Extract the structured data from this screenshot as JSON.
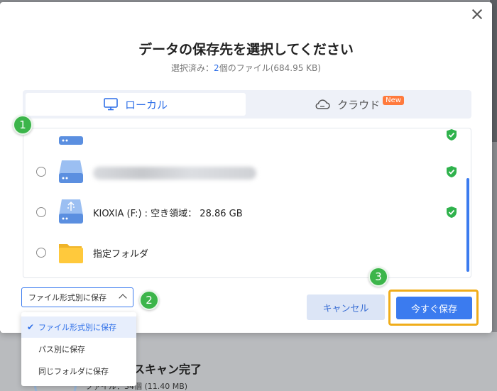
{
  "dialog": {
    "title": "データの保存先を選択してください",
    "subtitle_prefix": "選択済み：",
    "subtitle_count": "2",
    "subtitle_suffix": "個のファイル(684.95 KB)"
  },
  "tabs": [
    {
      "label": "ローカル",
      "icon": "monitor-icon",
      "active": true
    },
    {
      "label": "クラウド",
      "icon": "cloud-icon",
      "badge": "New",
      "active": false
    }
  ],
  "locations": [
    {
      "label": "",
      "icon": "drive-icon",
      "verified": true,
      "partially_visible": true
    },
    {
      "label": "",
      "icon": "drive-icon",
      "verified": true,
      "blurred": true
    },
    {
      "label": "KIOXIA (F:) : 空き領域： 28.86 GB",
      "icon": "usb-drive-icon",
      "verified": true
    },
    {
      "label": "指定フォルダ",
      "icon": "folder-icon",
      "verified": false
    }
  ],
  "format_select": {
    "value": "ファイル形式別に保存",
    "options": [
      {
        "label": "ファイル形式別に保存",
        "selected": true
      },
      {
        "label": "パス別に保存",
        "selected": false
      },
      {
        "label": "同じフォルダに保存",
        "selected": false
      }
    ]
  },
  "buttons": {
    "cancel": "キャンセル",
    "save": "今すぐ保存"
  },
  "markers": [
    "1",
    "2",
    "3"
  ],
  "background_app": {
    "status_title": "スキャン完了",
    "status_sub": "ファイル：34個 (11.40 MB)"
  },
  "colors": {
    "accent": "#3b7bef",
    "marker": "#3cb54a",
    "highlight": "#f0ad1a",
    "badge": "#ff7a3d",
    "verified": "#2fb24c"
  }
}
